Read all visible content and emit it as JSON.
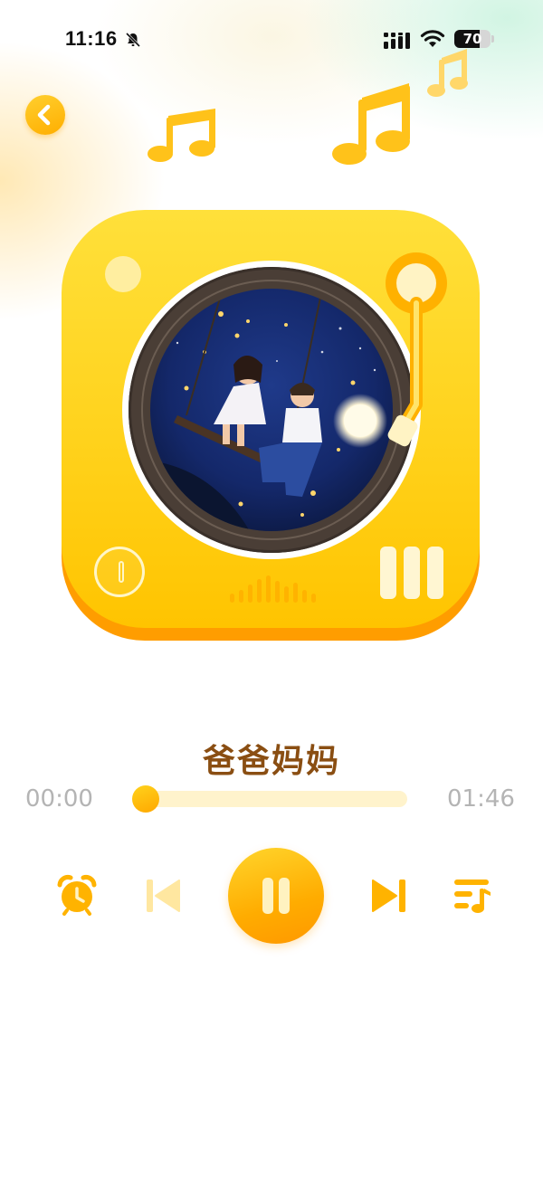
{
  "status_bar": {
    "time": "11:16",
    "battery": "70",
    "icons": [
      "bell-slash-icon",
      "signal-icon",
      "wifi-icon",
      "battery-icon"
    ]
  },
  "nav": {
    "back_icon": "chevron-left-icon"
  },
  "player": {
    "cover_art": "night-sky-swing-couple-illustration",
    "decor_icons": [
      "music-note-icon",
      "tonearm-icon",
      "power-icon",
      "equalizer-icon"
    ]
  },
  "track": {
    "title": "爸爸妈妈",
    "current_time": "00:00",
    "total_time": "01:46",
    "progress": 0.0
  },
  "controls": {
    "icons": [
      "alarm-clock-icon",
      "previous-icon",
      "pause-icon",
      "next-icon",
      "playlist-icon"
    ]
  },
  "colors": {
    "accent": "#ffb800",
    "title": "#8a4e12",
    "time_text": "#b4b4b4",
    "track_bg": "#fff3cc"
  }
}
